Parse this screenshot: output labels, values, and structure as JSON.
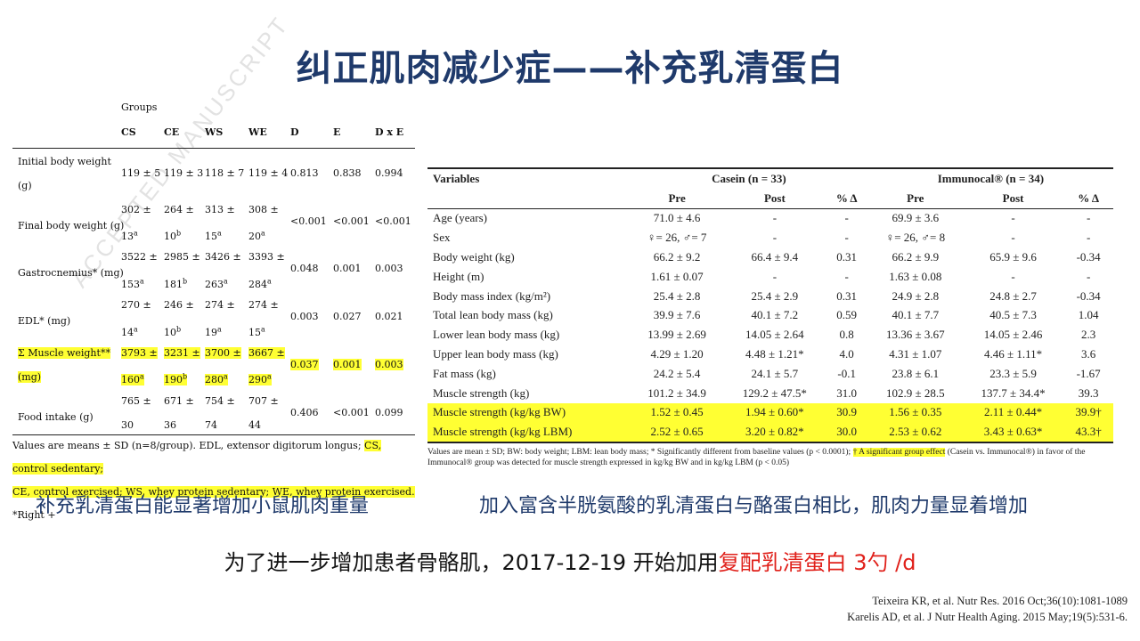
{
  "title": "纠正肌肉减少症——补充乳清蛋白",
  "left_table": {
    "watermark": "ACCEPTED MANUSCRIPT",
    "groups_label": "Groups",
    "headers": [
      "CS",
      "CE",
      "WS",
      "WE",
      "D",
      "E",
      "D x E"
    ],
    "rows": [
      {
        "label": [
          "Initial body weight",
          "(g)"
        ],
        "cells": [
          [
            "119 ± 5"
          ],
          [
            "119 ± 3"
          ],
          [
            "118 ± 7"
          ],
          [
            "119 ± 4"
          ],
          [
            "0.813"
          ],
          [
            "0.838"
          ],
          [
            "0.994"
          ]
        ],
        "hl": false
      },
      {
        "label": [
          "Final body weight (g)"
        ],
        "cells": [
          [
            "302 ±",
            "13",
            "a"
          ],
          [
            "264 ±",
            "10",
            "b"
          ],
          [
            "313 ±",
            "15",
            "a"
          ],
          [
            "308 ±",
            "20",
            "a"
          ],
          [
            "<0.001"
          ],
          [
            "<0.001"
          ],
          [
            "<0.001"
          ]
        ],
        "hl": false
      },
      {
        "label": [
          "Gastrocnemius* (mg)"
        ],
        "cells": [
          [
            "3522 ±",
            "153",
            "a"
          ],
          [
            "2985 ±",
            "181",
            "b"
          ],
          [
            "3426 ±",
            "263",
            "a"
          ],
          [
            "3393 ±",
            "284",
            "a"
          ],
          [
            "0.048"
          ],
          [
            "0.001"
          ],
          [
            "0.003"
          ]
        ],
        "hl": false
      },
      {
        "label": [
          "EDL* (mg)"
        ],
        "cells": [
          [
            "270 ±",
            "14",
            "a"
          ],
          [
            "246 ±",
            "10",
            "b"
          ],
          [
            "274 ±",
            "19",
            "a"
          ],
          [
            "274 ±",
            "15",
            "a"
          ],
          [
            "0.003"
          ],
          [
            "0.027"
          ],
          [
            "0.021"
          ]
        ],
        "hl": false
      },
      {
        "label": [
          "Σ Muscle weight**",
          "(mg)"
        ],
        "cells": [
          [
            "3793 ±",
            "160",
            "a"
          ],
          [
            "3231 ±",
            "190",
            "b"
          ],
          [
            "3700 ±",
            "280",
            "a"
          ],
          [
            "3667 ±",
            "290",
            "a"
          ],
          [
            "0.037"
          ],
          [
            "0.001"
          ],
          [
            "0.003"
          ]
        ],
        "hl": true
      },
      {
        "label": [
          "Food intake (g)"
        ],
        "cells": [
          [
            "765 ±",
            "30",
            ""
          ],
          [
            "671 ±",
            "36",
            ""
          ],
          [
            "754 ±",
            "74",
            ""
          ],
          [
            "707 ±",
            "44",
            ""
          ],
          [
            "0.406"
          ],
          [
            "<0.001"
          ],
          [
            "0.099"
          ]
        ],
        "hl": false
      }
    ],
    "footnote_a": "Values are means ± SD (n=8/group). EDL, extensor digitorum longus; ",
    "footnote_hl_1": "CS, control sedentary;",
    "footnote_hl_2": "CE, control exercised; WS, whey protein sedentary; WE, whey protein exercised.",
    "footnote_b": " *Right +"
  },
  "right_table": {
    "var_header": "Variables",
    "group1": "Casein (n = 33)",
    "group2": "Immunocal® (n = 34)",
    "sub": [
      "Pre",
      "Post",
      "% Δ",
      "Pre",
      "Post",
      "% Δ"
    ],
    "rows": [
      {
        "v": "Age (years)",
        "c": [
          "71.0 ± 4.6",
          "-",
          "-",
          "69.9 ± 3.6",
          "-",
          "-"
        ],
        "hl": false
      },
      {
        "v": "Sex",
        "c": [
          "♀= 26, ♂= 7",
          "-",
          "-",
          "♀= 26, ♂= 8",
          "-",
          "-"
        ],
        "hl": false
      },
      {
        "v": "Body weight (kg)",
        "c": [
          "66.2 ± 9.2",
          "66.4 ± 9.4",
          "0.31",
          "66.2 ± 9.9",
          "65.9 ± 9.6",
          "-0.34"
        ],
        "hl": false
      },
      {
        "v": "Height (m)",
        "c": [
          "1.61 ± 0.07",
          "-",
          "-",
          "1.63 ± 0.08",
          "-",
          "-"
        ],
        "hl": false
      },
      {
        "v": "Body mass index (kg/m²)",
        "c": [
          "25.4 ± 2.8",
          "25.4 ± 2.9",
          "0.31",
          "24.9 ± 2.8",
          "24.8 ± 2.7",
          "-0.34"
        ],
        "hl": false
      },
      {
        "v": "Total lean body mass (kg)",
        "c": [
          "39.9 ± 7.6",
          "40.1 ± 7.2",
          "0.59",
          "40.1 ± 7.7",
          "40.5 ± 7.3",
          "1.04"
        ],
        "hl": false
      },
      {
        "v": "Lower lean body mass (kg)",
        "c": [
          "13.99 ± 2.69",
          "14.05 ± 2.64",
          "0.8",
          "13.36 ± 3.67",
          "14.05 ± 2.46",
          "2.3"
        ],
        "hl": false
      },
      {
        "v": "Upper lean body mass (kg)",
        "c": [
          "4.29 ± 1.20",
          "4.48 ± 1.21*",
          "4.0",
          "4.31 ± 1.07",
          "4.46 ± 1.11*",
          "3.6"
        ],
        "hl": false
      },
      {
        "v": "Fat mass (kg)",
        "c": [
          "24.2 ± 5.4",
          "24.1 ± 5.7",
          "-0.1",
          "23.8 ± 6.1",
          "23.3 ± 5.9",
          "-1.67"
        ],
        "hl": false
      },
      {
        "v": "Muscle strength (kg)",
        "c": [
          "101.2 ± 34.9",
          "129.2 ± 47.5*",
          "31.0",
          "102.9 ± 28.5",
          "137.7 ± 34.4*",
          "39.3"
        ],
        "hl": false
      },
      {
        "v": "Muscle strength (kg/kg BW)",
        "c": [
          "1.52 ± 0.45",
          "1.94 ± 0.60*",
          "30.9",
          "1.56 ± 0.35",
          "2.11 ± 0.44*",
          "39.9†"
        ],
        "hl": true
      },
      {
        "v": "Muscle strength (kg/kg LBM)",
        "c": [
          "2.52 ± 0.65",
          "3.20 ± 0.82*",
          "30.0",
          "2.53 ± 0.62",
          "3.43 ± 0.63*",
          "43.3†"
        ],
        "hl": true
      }
    ],
    "note_a": "Values are mean ± SD; BW: body weight; LBM: lean body mass; * Significantly different from baseline values (p < 0.0001); ",
    "note_hl": "† A significant group effect",
    "note_b": " (Casein vs. Immunocal®) in favor of the Immunocal® group was detected for muscle strength expressed in kg/kg BW and in kg/kg LBM (p < 0.05)"
  },
  "caption_left": "补充乳清蛋白能显著增加小鼠肌肉重量",
  "caption_right": "加入富含半胱氨酸的乳清蛋白与酪蛋白相比，肌肉力量显着增加",
  "main_text": "为了进一步增加患者骨骼肌，2017-12-19 开始加用",
  "main_red": "复配乳清蛋白 3勺 /d",
  "refs": [
    "Teixeira KR, et al. Nutr Res. 2016 Oct;36(10):1081-1089",
    "Karelis AD, et al. J Nutr Health Aging. 2015 May;19(5):531-6."
  ]
}
